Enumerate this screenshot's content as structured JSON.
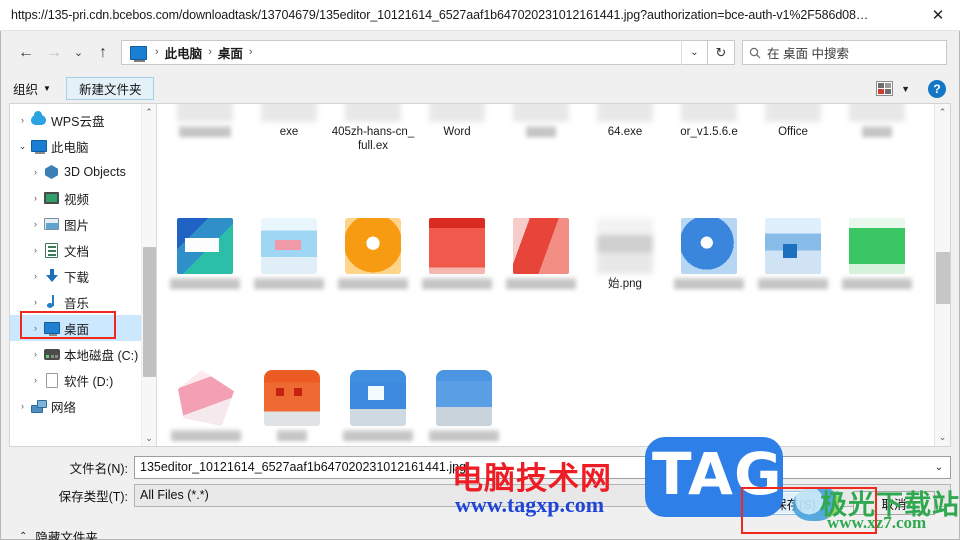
{
  "titlebar": {
    "url": "https://135-pri.cdn.bcebos.com/downloadtask/13704679/135editor_10121614_6527aaf1b647020231012161441.jpg?authorization=bce-auth-v1%2F586d08…",
    "close_label": "✕"
  },
  "nav": {
    "back": "←",
    "forward": "→",
    "recent": "⌄",
    "up": "↑",
    "refresh": "↻",
    "breadcrumb_dropdown": "⌄",
    "breadcrumb": [
      {
        "label": "此电脑",
        "sep": "›"
      },
      {
        "label": "桌面",
        "sep": "›"
      }
    ],
    "pc_icon": "computer-icon"
  },
  "search": {
    "icon": "search-icon",
    "placeholder": "在 桌面 中搜索"
  },
  "commandbar": {
    "organize_label": "组织",
    "organize_caret": "▼",
    "new_folder_label": "新建文件夹",
    "view_icon": "view-options-icon",
    "view_caret": "▼",
    "help_label": "?"
  },
  "sidebar": {
    "items": [
      {
        "label": "WPS云盘",
        "icon": "cloud-icon",
        "twisty": "›",
        "indent": false,
        "selected": false
      },
      {
        "label": "此电脑",
        "icon": "pc-icon",
        "twisty": "⌄",
        "indent": false,
        "selected": false
      },
      {
        "label": "3D Objects",
        "icon": "3d-icon",
        "twisty": "›",
        "indent": true,
        "selected": false
      },
      {
        "label": "视频",
        "icon": "video-icon",
        "twisty": "›",
        "indent": true,
        "selected": false
      },
      {
        "label": "图片",
        "icon": "picture-icon",
        "twisty": "›",
        "indent": true,
        "selected": false
      },
      {
        "label": "文档",
        "icon": "document-icon",
        "twisty": "›",
        "indent": true,
        "selected": false
      },
      {
        "label": "下载",
        "icon": "download-icon",
        "twisty": "›",
        "indent": true,
        "selected": false
      },
      {
        "label": "音乐",
        "icon": "music-icon",
        "twisty": "›",
        "indent": true,
        "selected": false
      },
      {
        "label": "桌面",
        "icon": "desktop-icon",
        "twisty": "›",
        "indent": true,
        "selected": true
      },
      {
        "label": "本地磁盘 (C:)",
        "icon": "disk-icon",
        "twisty": "›",
        "indent": true,
        "selected": false
      },
      {
        "label": "软件 (D:)",
        "icon": "file-icon",
        "twisty": "›",
        "indent": true,
        "selected": false
      },
      {
        "label": "网络",
        "icon": "network-icon",
        "twisty": "›",
        "indent": false,
        "selected": false
      }
    ],
    "scroll_up": "⌃",
    "scroll_down": "⌄"
  },
  "filepane": {
    "scroll_up": "⌃",
    "scroll_down": "⌄",
    "rows": [
      {
        "cells": [
          {
            "label": "",
            "label_blurred": true,
            "thumb": "thumb-gray",
            "blur": true
          },
          {
            "label": "exe",
            "label_blurred": false,
            "thumb": "thumb-gray",
            "blur": true
          },
          {
            "label": "405zh-hans-cn_full.ex",
            "label_blurred": false,
            "thumb": "thumb-gray",
            "blur": true
          },
          {
            "label": "Word",
            "label_blurred": false,
            "thumb": "thumb-gray",
            "blur": true
          },
          {
            "label": "",
            "label_blurred": true,
            "thumb": "thumb-gray",
            "blur": true
          },
          {
            "label": "64.exe",
            "label_blurred": false,
            "thumb": "thumb-gray",
            "blur": true
          },
          {
            "label": "or_v1.5.6.e",
            "label_blurred": false,
            "thumb": "thumb-gray",
            "blur": true
          },
          {
            "label": "Office",
            "label_blurred": false,
            "thumb": "thumb-gray",
            "blur": true
          },
          {
            "label": "",
            "label_blurred": true,
            "thumb": "thumb-gray",
            "blur": true
          }
        ]
      },
      {
        "cells": [
          {
            "label": "",
            "label_blurred": true,
            "thumb": "thumb-teal",
            "blur": true
          },
          {
            "label": "",
            "label_blurred": true,
            "thumb": "thumb-lightblue",
            "blur": true
          },
          {
            "label": "",
            "label_blurred": true,
            "thumb": "thumb-orange",
            "blur": true
          },
          {
            "label": "",
            "label_blurred": true,
            "thumb": "thumb-red",
            "blur": true
          },
          {
            "label": "",
            "label_blurred": true,
            "thumb": "thumb-red2",
            "blur": true
          },
          {
            "label": "始.png",
            "label_blurred": false,
            "thumb": "thumb-gray",
            "blur": true
          },
          {
            "label": "",
            "label_blurred": true,
            "thumb": "thumb-blue",
            "blur": true
          },
          {
            "label": "",
            "label_blurred": true,
            "thumb": "thumb-bluesoft",
            "blur": true
          },
          {
            "label": "",
            "label_blurred": true,
            "thumb": "thumb-green",
            "blur": true
          }
        ]
      },
      {
        "cells": [
          {
            "label": "",
            "label_blurred": true,
            "thumb": "thumb-pink",
            "blur": true
          },
          {
            "label": "",
            "label_blurred": true,
            "thumb": "thumb-orangebig",
            "blur": true
          },
          {
            "label": "",
            "label_blurred": true,
            "thumb": "thumb-bluefolder",
            "blur": true
          },
          {
            "label": "",
            "label_blurred": true,
            "thumb": "thumb-bluefolder2",
            "blur": true
          }
        ]
      }
    ]
  },
  "form": {
    "filename_label": "文件名(N):",
    "filename_value": "135editor_10121614_6527aaf1b647020231012161441.jpg",
    "filename_caret": "⌄",
    "filetype_label": "保存类型(T):",
    "filetype_value": "All Files (*.*)",
    "filetype_caret": "⌄"
  },
  "footer": {
    "hide_folders_caret": "⌃",
    "hide_folders_label": "隐藏文件夹",
    "save_label": "保存(S)",
    "cancel_label": "取消"
  },
  "watermarks": {
    "site_name": "电脑技术网",
    "site_url": "www.tagxp.com",
    "tag_text": "TAG",
    "xz_name": "极光下载站",
    "xz_url": "www.xz7.com"
  },
  "colors": {
    "accent_blue": "#1a7fd4",
    "selection_blue": "#cce8ff",
    "annotation_red": "#ef2a1c",
    "watermark_red": "#ee1d25",
    "watermark_blue": "#2f7fe8",
    "watermark_green": "#2fa84f"
  }
}
